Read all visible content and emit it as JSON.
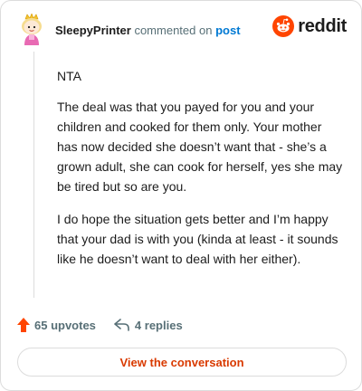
{
  "header": {
    "username": "SleepyPrinter",
    "action_text": "commented on",
    "post_link": "post",
    "logo_text": "reddit"
  },
  "comment": {
    "paragraphs": [
      "NTA",
      "The deal was that you payed for you and your children and cooked for them only. Your mother has now decided she doesn’t want that - she’s a grown adult, she can cook for herself, yes she may be tired but so are you.",
      "I do hope the situation gets better and I’m happy that your dad is with you (kinda at least - it sounds like he doesn’t want to deal with her either)."
    ]
  },
  "actions": {
    "upvotes": "65 upvotes",
    "replies": "4 replies"
  },
  "cta": {
    "label": "View the conversation"
  },
  "colors": {
    "accent": "#d93a00",
    "link": "#0079d3",
    "reddit_orange": "#ff4500",
    "muted": "#576f76"
  },
  "icons": {
    "avatar": "snoo-avatar",
    "logo": "reddit-snoo-icon",
    "upvote": "upvote-arrow-icon",
    "reply": "reply-arrow-icon"
  }
}
